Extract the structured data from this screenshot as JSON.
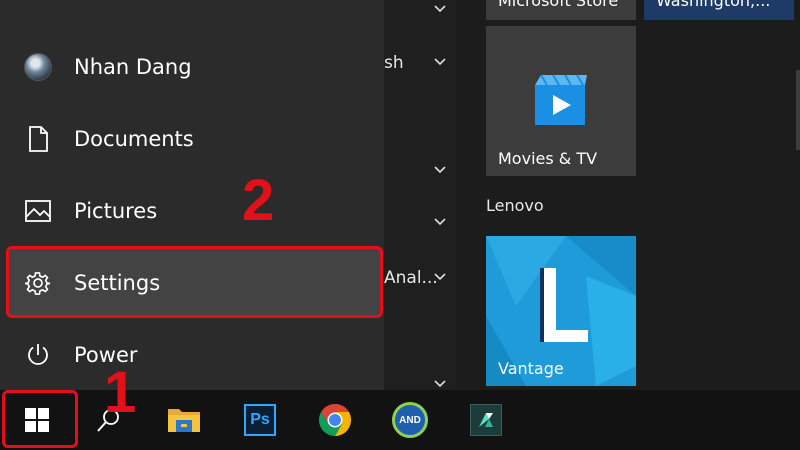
{
  "user": {
    "name": "Nhan Dang"
  },
  "rail": {
    "documents": "Documents",
    "pictures": "Pictures",
    "settings": "Settings",
    "power": "Power"
  },
  "annotations": {
    "step1": "1",
    "step2": "2"
  },
  "applist": {
    "fragment1": "sh",
    "fragment2": "Anal..."
  },
  "tiles": {
    "store": "Microsoft Store",
    "weather": "Washington,...",
    "movies": "Movies & TV",
    "group_lenovo": "Lenovo",
    "vantage": "Vantage"
  },
  "taskbar": {
    "apps": [
      "start-icon",
      "search-icon",
      "file-explorer-icon",
      "photoshop-icon",
      "chrome-icon",
      "and-app-icon",
      "filmora-icon"
    ],
    "photoshop_text": "Ps",
    "and_text": "AND"
  },
  "colors": {
    "annotation_red": "#e3101a",
    "tile_blue": "#1e9bd8",
    "movies_tile": "#3c3c3c"
  }
}
